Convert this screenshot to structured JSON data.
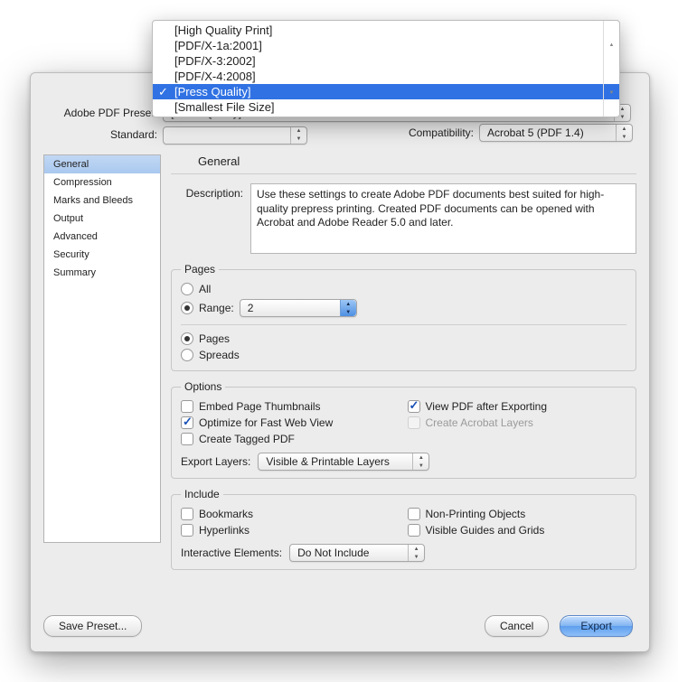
{
  "labels": {
    "preset": "Adobe PDF Preset:",
    "standard": "Standard:",
    "compat": "Compatibility:",
    "compat_value": "Acrobat 5 (PDF 1.4)"
  },
  "preset_options": [
    "[High Quality Print]",
    "[PDF/X-1a:2001]",
    "[PDF/X-3:2002]",
    "[PDF/X-4:2008]",
    "[Press Quality]",
    "[Smallest File Size]"
  ],
  "preset_selected_index": 4,
  "sidebar": {
    "items": [
      "General",
      "Compression",
      "Marks and Bleeds",
      "Output",
      "Advanced",
      "Security",
      "Summary"
    ],
    "selected_index": 0
  },
  "general": {
    "heading": "General",
    "description_label": "Description:",
    "description": "Use these settings to create Adobe PDF documents best suited for high-quality prepress printing.  Created PDF documents can be opened with Acrobat and Adobe Reader 5.0 and later.",
    "pages_legend": "Pages",
    "pages_all": "All",
    "pages_range": "Range:",
    "pages_range_value": "2",
    "pages_pages": "Pages",
    "pages_spreads": "Spreads",
    "options_legend": "Options",
    "opt_embed": "Embed Page Thumbnails",
    "opt_view": "View PDF after Exporting",
    "opt_fastweb": "Optimize for Fast Web View",
    "opt_layers": "Create Acrobat Layers",
    "opt_tagged": "Create Tagged PDF",
    "export_layers_label": "Export Layers:",
    "export_layers_value": "Visible & Printable Layers",
    "include_legend": "Include",
    "inc_bookmarks": "Bookmarks",
    "inc_nonprint": "Non-Printing Objects",
    "inc_hyperlinks": "Hyperlinks",
    "inc_guides": "Visible Guides and Grids",
    "interactive_label": "Interactive Elements:",
    "interactive_value": "Do Not Include"
  },
  "buttons": {
    "save_preset": "Save Preset...",
    "cancel": "Cancel",
    "export": "Export"
  }
}
